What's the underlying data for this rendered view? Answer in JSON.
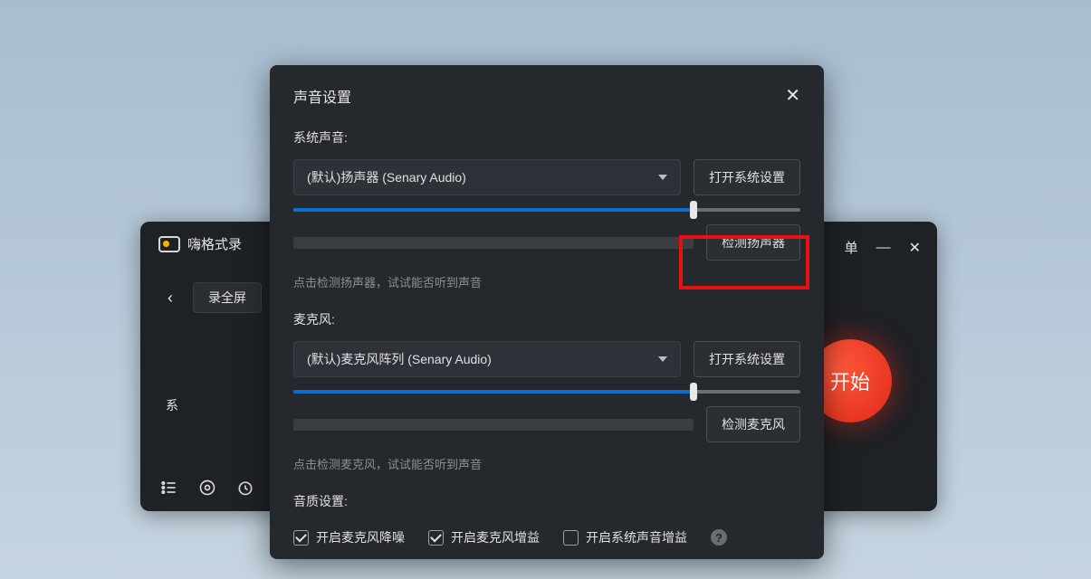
{
  "app": {
    "title": "嗨格式录",
    "menu_label": "单",
    "back_icon": "‹",
    "mode_button": "录全屏",
    "body_text": "系",
    "start_label": "开始"
  },
  "dialog": {
    "title": "声音设置",
    "system_sound": {
      "label": "系统声音:",
      "device": "(默认)扬声器 (Senary Audio)",
      "open_settings": "打开系统设置",
      "test_button": "检测扬声器",
      "volume_percent": 79,
      "hint": "点击检测扬声器，试试能否听到声音"
    },
    "microphone": {
      "label": "麦克风:",
      "device": "(默认)麦克风阵列 (Senary Audio)",
      "open_settings": "打开系统设置",
      "test_button": "检测麦克风",
      "volume_percent": 79,
      "hint": "点击检测麦克风，试试能否听到声音"
    },
    "quality": {
      "label": "音质设置:",
      "noise_reduction": {
        "label": "开启麦克风降噪",
        "checked": true
      },
      "mic_gain": {
        "label": "开启麦克风增益",
        "checked": true
      },
      "system_gain": {
        "label": "开启系统声音增益",
        "checked": false
      }
    }
  }
}
